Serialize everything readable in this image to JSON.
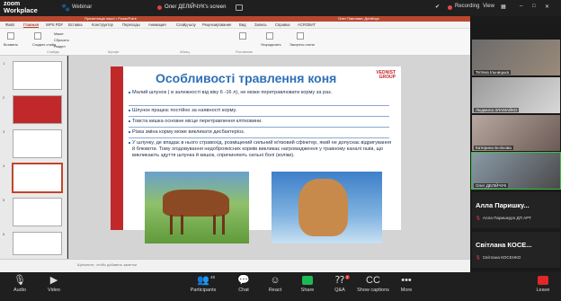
{
  "zoom": {
    "app_title_line1": "zoom",
    "app_title_line2": "Workplace",
    "meeting_type": "Webinar",
    "share_title": "Олег ДЕЛІЙЧУК's screen",
    "recording_label": "Recording",
    "view_label": "View"
  },
  "ppt": {
    "title_center": "Презентація іншої • PowerPoint",
    "title_user": "Олег Павлович Делійчук",
    "tabs": [
      "Файл",
      "Главная",
      "WPS PDF",
      "Вставка",
      "Конструктор",
      "Переходы",
      "Анимация",
      "Слайд-шоу",
      "Рецензирование",
      "Вид",
      "Запись",
      "Справка",
      "ACROBAT"
    ],
    "active_tab": "Главная",
    "ribbon_labels": [
      "Вставить",
      "Создать слайд",
      "Макет",
      "Сбросить",
      "Раздел",
      "Слайды",
      "Шрифт",
      "Абзац",
      "Рисование",
      "Упорядочить",
      "Экспресс-стили"
    ],
    "notes_placeholder": "Щелкните, чтобы добавить заметки"
  },
  "slide": {
    "title": "Особливості травлення коня",
    "logo_line1": "VEDNIST",
    "logo_line2": "GROUP",
    "bullets": [
      "Малий шлунок ( в залежності від віку 6 -16 л), не може перетравлювати корму за раз.",
      "Шлунок працює постійно за наявності корму.",
      "Товста кишка основне місце перетравлення клітковини.",
      "Різка зміна корму може викликати дисбактеріоз.",
      "У шлунку, де впадає в нього стравохід, розміщений сильний м'язовий сфінктер, який не допускає відригування й блювоти. Тому згодовування недоброякісних кормів викликає нагромадження у травному каналі газів, що викликають здуття шлунка й кишок, спричиняють сильні болі (коліки)."
    ]
  },
  "thumbnails": [
    "1",
    "2",
    "3",
    "4",
    "5",
    "6"
  ],
  "participants": {
    "video": [
      "Тетяна Ільницька",
      "Людмила ЗЛАМАЙКО",
      "Катерина Бєлікова",
      "Олег ДЕЛІЙЧУК"
    ],
    "tiles": [
      {
        "name": "Алла  Паришку...",
        "sub": "Алла Паришкуро ДП АРТ"
      },
      {
        "name": "Світлана  КОСЕ...",
        "sub": "Світлана КОСЕНКО"
      }
    ]
  },
  "toolbar": {
    "audio": "Audio",
    "video": "Video",
    "participants": "Participants",
    "participants_count": "48",
    "chat": "Chat",
    "react": "React",
    "share": "Share",
    "qa": "Q&A",
    "qa_count": "2",
    "captions": "Show captions",
    "more": "More",
    "leave": "Leave"
  }
}
